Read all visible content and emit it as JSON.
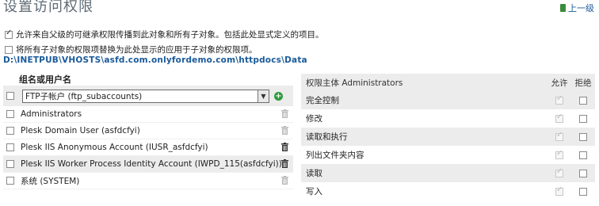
{
  "page": {
    "title": "设置访问权限",
    "up_link": "上一级"
  },
  "options": {
    "inherit_label": "允许来自父级的可继承权限传播到此对象和所有子对象。包括此处显式定义的项目。",
    "inherit_checked": true,
    "replace_label": "将所有子对象的权限项替换为此处显示的应用于子对象的权限项。",
    "replace_checked": false
  },
  "path": "D:\\INETPUB\\VHOSTS\\asfd.com.onlyfordemo.com\\httpdocs\\Data",
  "users": {
    "header": "组名或用户名",
    "select_value": "FTP子帐户 (ftp_subaccounts)",
    "rows": [
      {
        "name": "Administrators",
        "trash_active": false
      },
      {
        "name": "Plesk Domain User (asfdcfyi)",
        "trash_active": false
      },
      {
        "name": "Plesk IIS Anonymous Account (IUSR_asfdcfyi)",
        "trash_active": true
      },
      {
        "name": "Plesk IIS Worker Process Identity Account (IWPD_115(asfdcfyi))",
        "trash_active": true
      },
      {
        "name": "系统 (SYSTEM)",
        "trash_active": false
      }
    ]
  },
  "permissions": {
    "principal_header": "权限主体 Administrators",
    "allow_header": "允许",
    "deny_header": "拒绝",
    "rows": [
      {
        "name": "完全控制",
        "allow": true,
        "deny": false
      },
      {
        "name": "修改",
        "allow": true,
        "deny": false
      },
      {
        "name": "读取和执行",
        "allow": true,
        "deny": false
      },
      {
        "name": "列出文件夹内容",
        "allow": true,
        "deny": false
      },
      {
        "name": "读取",
        "allow": true,
        "deny": false
      },
      {
        "name": "写入",
        "allow": true,
        "deny": false
      }
    ]
  }
}
